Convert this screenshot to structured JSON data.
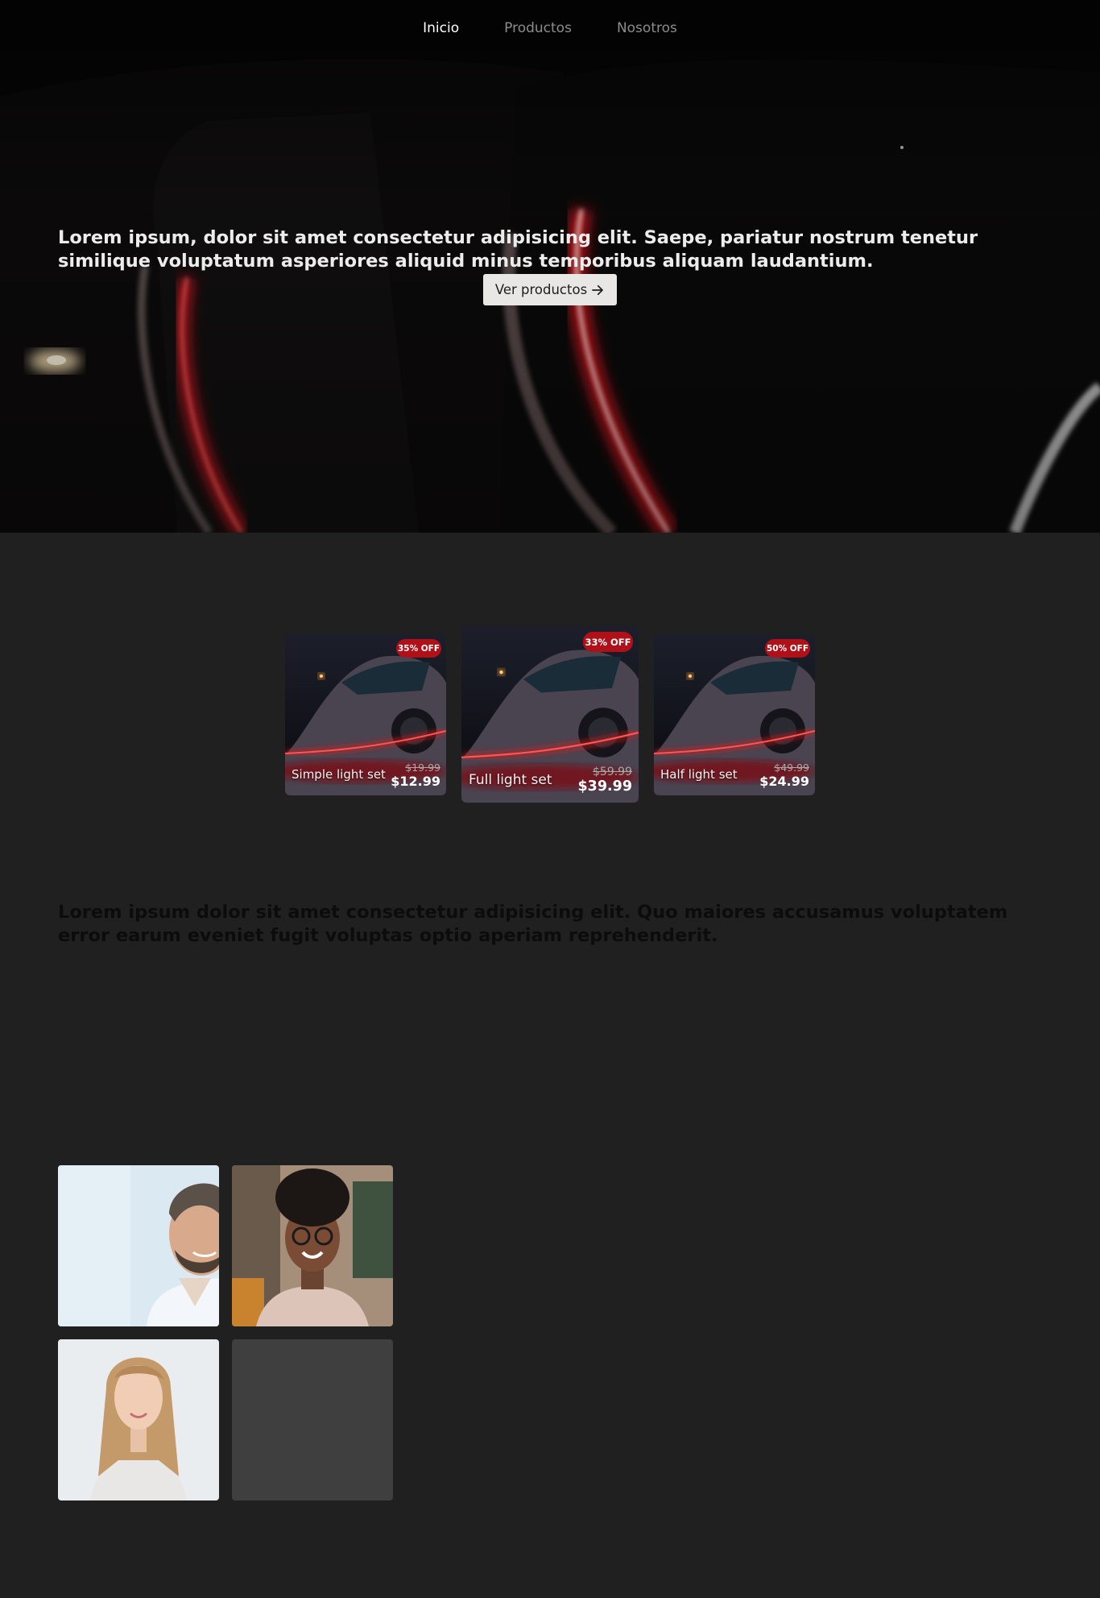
{
  "nav": {
    "items": [
      {
        "label": "Inicio",
        "active": true
      },
      {
        "label": "Productos",
        "active": false
      },
      {
        "label": "Nosotros",
        "active": false
      }
    ]
  },
  "hero": {
    "text": "Lorem ipsum, dolor sit amet consectetur adipisicing elit. Saepe, pariatur nostrum tenetur similique voluptatum asperiores aliquid minus temporibus aliquam laudantium.",
    "button_label": "Ver productos",
    "button_icon": "arrow-right-icon"
  },
  "products": [
    {
      "name": "Simple light set",
      "badge": "35% OFF",
      "old_price": "$19.99",
      "price": "$12.99"
    },
    {
      "name": "Full light set",
      "badge": "33% OFF",
      "old_price": "$59.99",
      "price": "$39.99"
    },
    {
      "name": "Half light set",
      "badge": "50% OFF",
      "old_price": "$49.99",
      "price": "$24.99"
    }
  ],
  "about": {
    "text": "Lorem ipsum dolor sit amet consectetur adipisicing elit. Quo maiores accusamus voluptatem error earum eveniet fugit voluptas optio aperiam reprehenderit."
  },
  "colors": {
    "page_bg": "#202020",
    "badge": "#b01018",
    "accent_red": "#d21a1a",
    "empty_tile": "#3f3f3f"
  }
}
